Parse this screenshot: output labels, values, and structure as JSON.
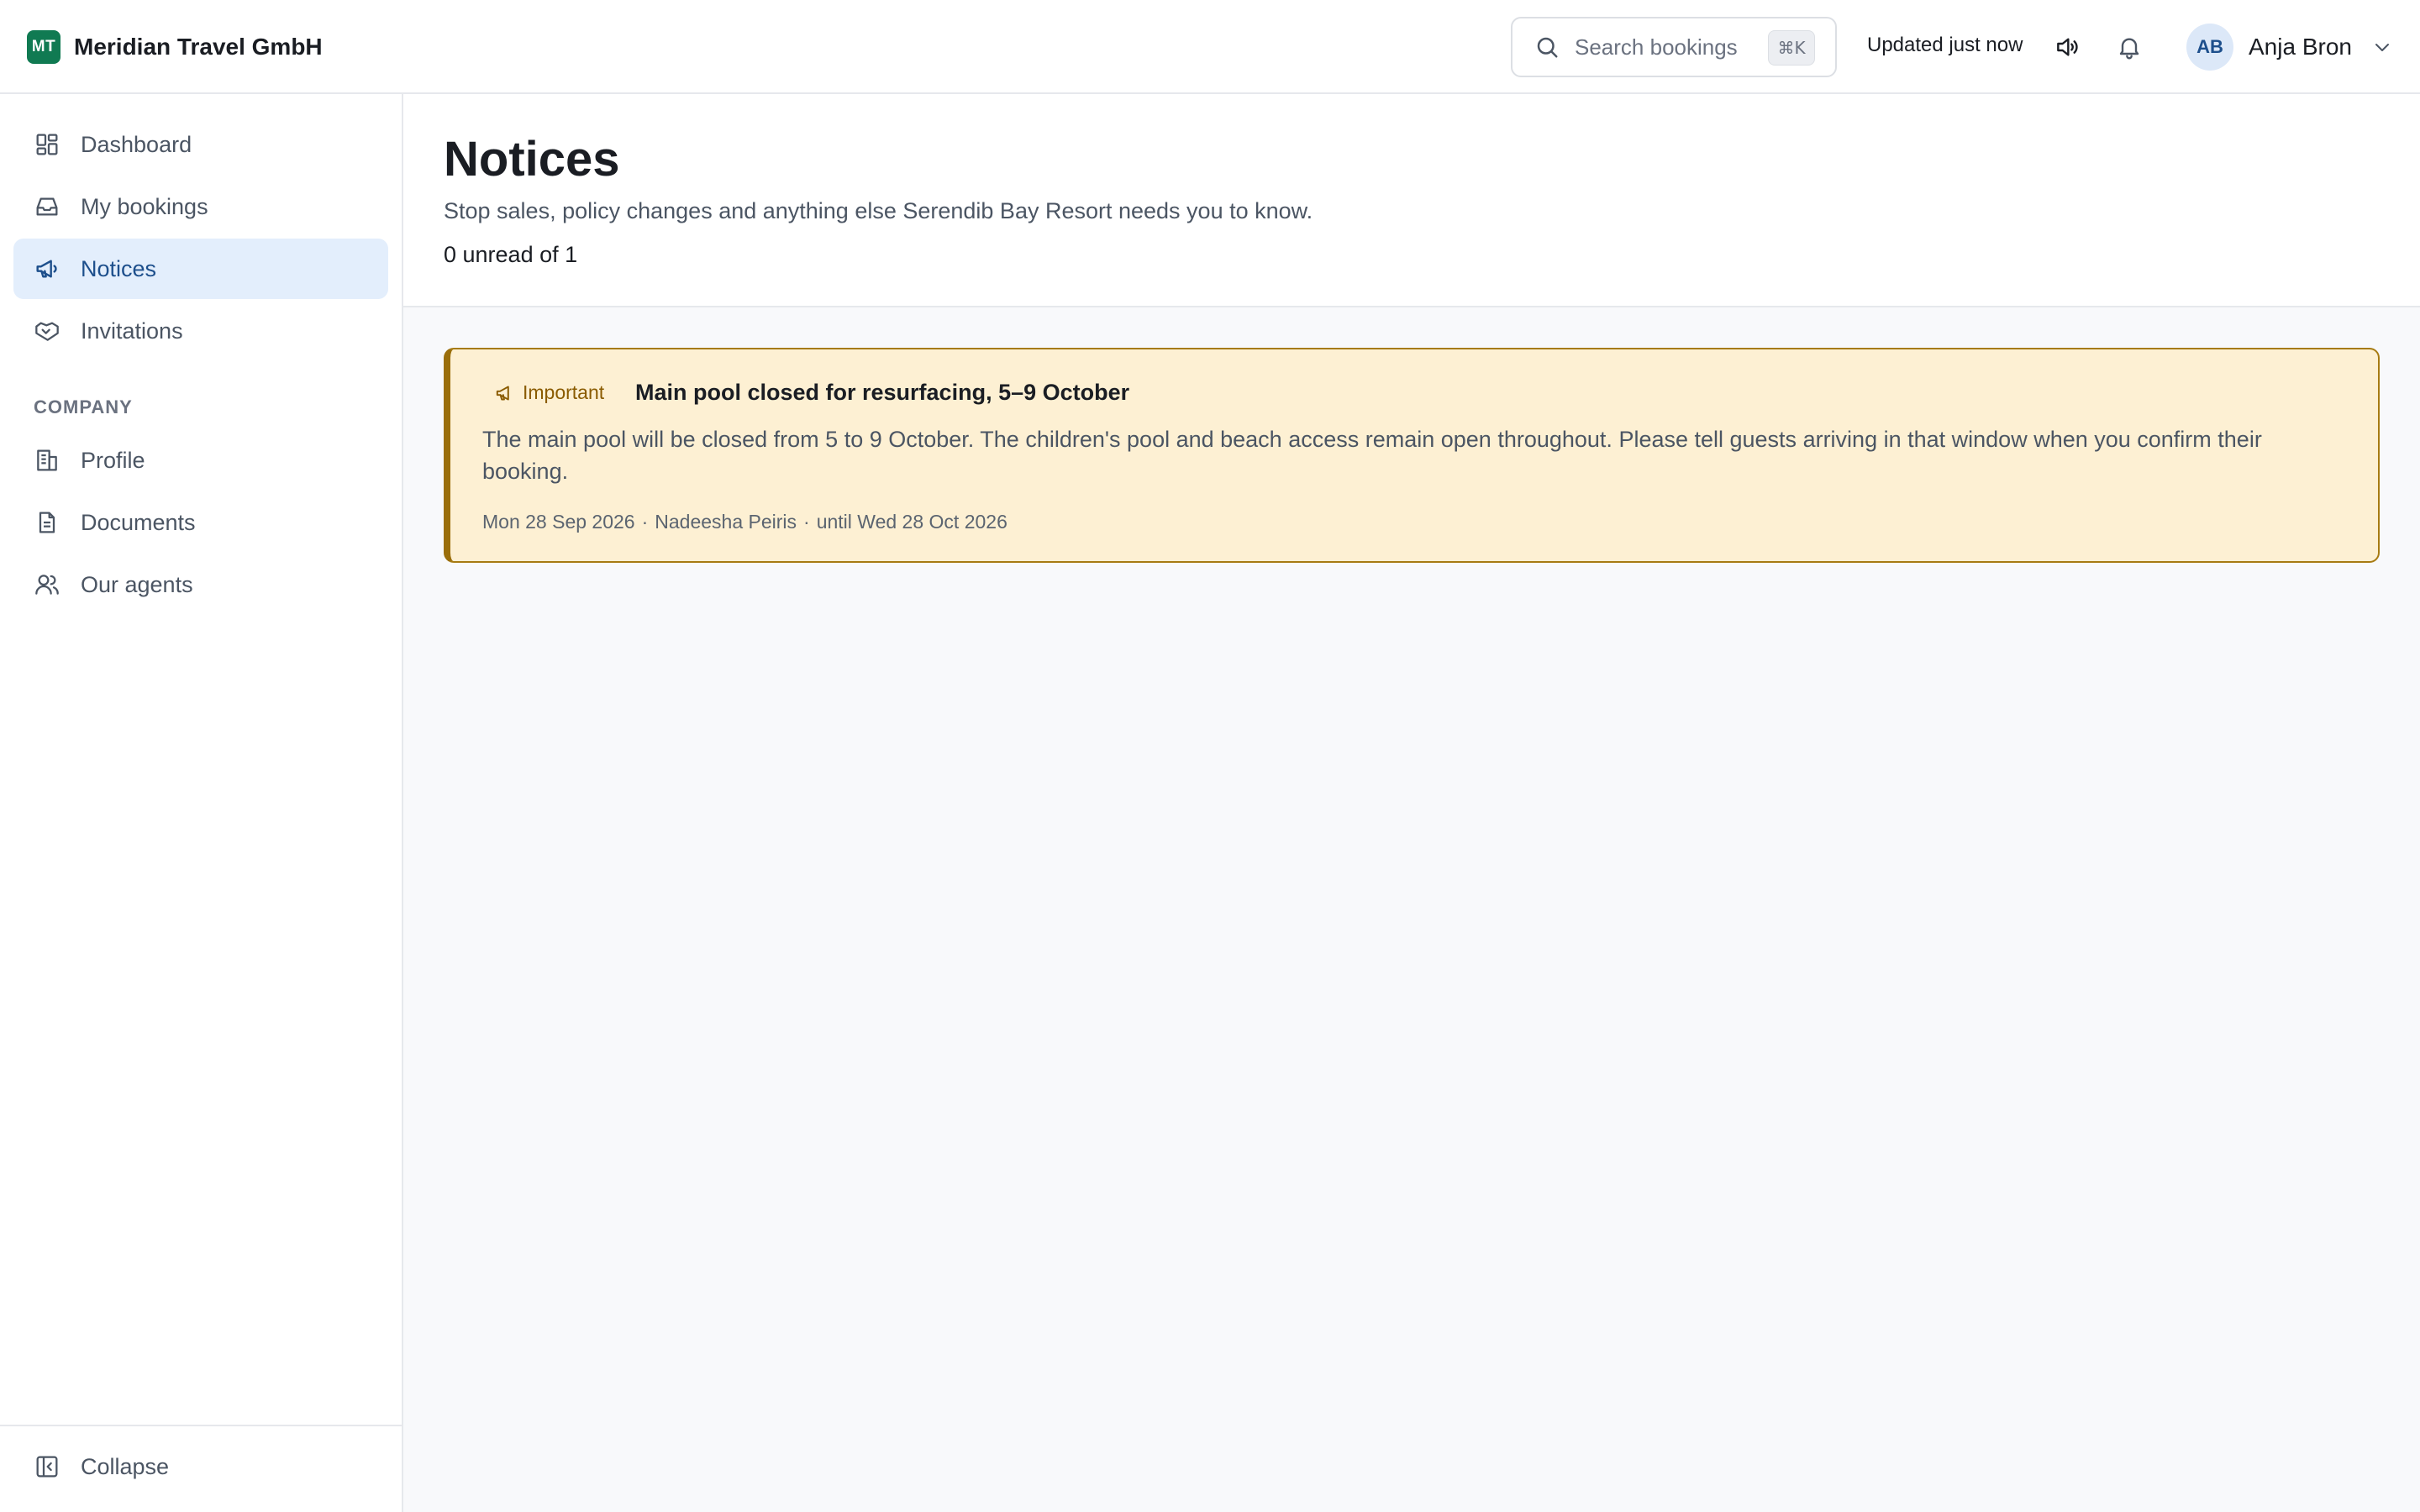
{
  "app": {
    "brand_initials": "MT",
    "brand_name": "Meridian Travel GmbH"
  },
  "topbar": {
    "search_placeholder": "Search bookings",
    "search_shortcut": "⌘K",
    "updated_text": "Updated just now",
    "sound_icon": "speaker-icon",
    "notifications_icon": "bell-icon",
    "user_initials": "AB",
    "user_name": "Anja Bron"
  },
  "sidebar": {
    "items": [
      {
        "label": "Dashboard",
        "icon": "dashboard-icon",
        "active": false
      },
      {
        "label": "My bookings",
        "icon": "inbox-icon",
        "active": false
      },
      {
        "label": "Notices",
        "icon": "megaphone-icon",
        "active": true
      },
      {
        "label": "Invitations",
        "icon": "handshake-icon",
        "active": false
      }
    ],
    "section_label": "COMPANY",
    "company_items": [
      {
        "label": "Profile",
        "icon": "building-icon"
      },
      {
        "label": "Documents",
        "icon": "document-icon"
      },
      {
        "label": "Our agents",
        "icon": "users-icon"
      }
    ],
    "collapse_label": "Collapse"
  },
  "page": {
    "title": "Notices",
    "subtitle": "Stop sales, policy changes and anything else Serendib Bay Resort needs you to know.",
    "unread_summary": "0 unread of 1"
  },
  "notices": [
    {
      "badge": "Important",
      "title": "Main pool closed for resurfacing, 5–9 October",
      "body": "The main pool will be closed from 5 to 9 October. The children's pool and beach access remain open throughout. Please tell guests arriving in that window when you confirm their booking.",
      "date": "Mon 28 Sep 2026",
      "author": "Nadeesha Peiris",
      "until": "until Wed 28 Oct 2026"
    }
  ],
  "colors": {
    "brand": "#107a52",
    "active_nav_bg": "#e3eefc",
    "active_nav_text": "#1d4f8c",
    "notice_bg": "#fdf0d3",
    "notice_border": "#a77b12"
  }
}
